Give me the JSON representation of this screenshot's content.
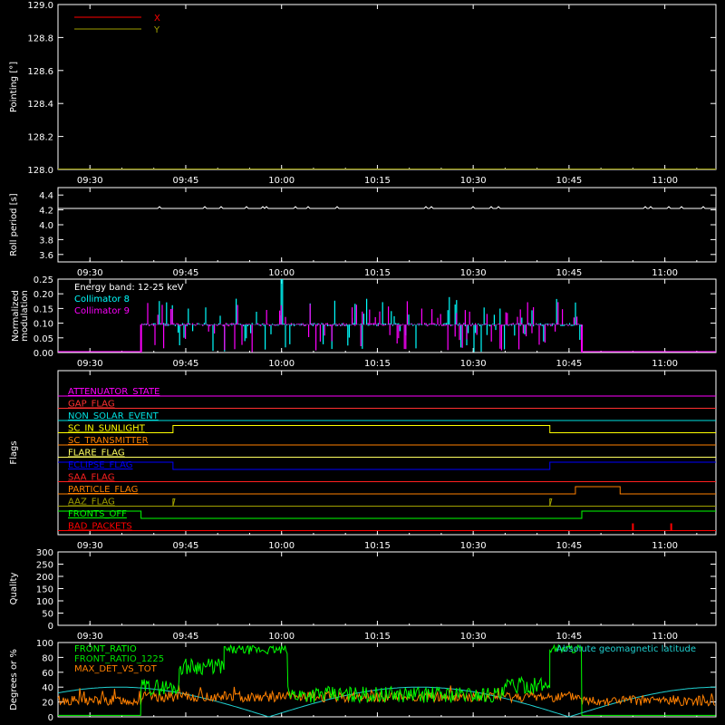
{
  "time_ticks": [
    "09:30",
    "09:45",
    "10:00",
    "10:15",
    "10:30",
    "10:45",
    "11:00"
  ],
  "chart_data": [
    {
      "type": "line",
      "name": "pointing",
      "ylabel": "Pointing [°]",
      "ylim": [
        128.0,
        129.0
      ],
      "yticks": [
        "128.0",
        "128.2",
        "128.4",
        "128.6",
        "128.8",
        "129.0"
      ],
      "legend_position": "top-left",
      "series": [
        {
          "name": "X",
          "color": "#ff0000",
          "x": [
            "09:25",
            "11:08"
          ],
          "values": [
            128.0,
            128.0
          ]
        },
        {
          "name": "Y",
          "color": "#a0a000",
          "x": [
            "09:25",
            "11:08"
          ],
          "values": [
            128.0,
            128.0
          ]
        }
      ]
    },
    {
      "type": "line",
      "name": "roll-period",
      "ylabel": "Roll period [s]",
      "ylim": [
        3.5,
        4.5
      ],
      "yticks": [
        "3.6",
        "3.8",
        "4.0",
        "4.2",
        "4.4"
      ],
      "series": [
        {
          "name": "",
          "color": "#ffffff",
          "x": [
            "09:25",
            "11:08"
          ],
          "values": [
            4.22,
            4.22
          ]
        }
      ]
    },
    {
      "type": "bar",
      "name": "modulation",
      "ylabel": "Normalized modulation",
      "ylim": [
        0,
        0.25
      ],
      "yticks": [
        "0.00",
        "0.05",
        "0.10",
        "0.15",
        "0.20",
        "0.25"
      ],
      "annotation": "Energy band: 12-25 keV",
      "data_range": [
        "09:38",
        "10:47"
      ],
      "baseline": 0.095,
      "series": [
        {
          "name": "Collimator 8",
          "color": "#00ffff"
        },
        {
          "name": "Collimator 9",
          "color": "#ff00ff"
        }
      ]
    },
    {
      "type": "line",
      "name": "flags",
      "ylabel": "Flags",
      "flags": [
        {
          "label": "ATTENUATOR_STATE",
          "color": "#ff00ff",
          "segments": [
            [
              "09:25",
              "11:08",
              0
            ]
          ]
        },
        {
          "label": "GAP_FLAG",
          "color": "#ff3030",
          "segments": [
            [
              "09:25",
              "11:08",
              0
            ]
          ]
        },
        {
          "label": "NON_SOLAR_EVENT",
          "color": "#00e0e0",
          "segments": [
            [
              "09:25",
              "11:08",
              0
            ]
          ]
        },
        {
          "label": "SC_IN_SUNLIGHT",
          "color": "#ffff00",
          "segments": [
            [
              "09:25",
              "09:43",
              0
            ],
            [
              "09:43",
              "10:42",
              1
            ],
            [
              "10:42",
              "11:08",
              0
            ]
          ]
        },
        {
          "label": "SC_TRANSMITTER",
          "color": "#ff8000",
          "segments": [
            [
              "09:25",
              "11:08",
              0
            ]
          ]
        },
        {
          "label": "FLARE_FLAG",
          "color": "#ffff60",
          "segments": [
            [
              "09:25",
              "11:08",
              0
            ]
          ]
        },
        {
          "label": "ECLIPSE_FLAG",
          "color": "#0000ff",
          "segments": [
            [
              "09:25",
              "09:43",
              1
            ],
            [
              "09:43",
              "10:42",
              0
            ],
            [
              "10:42",
              "11:08",
              1
            ]
          ]
        },
        {
          "label": "SAA_FLAG",
          "color": "#ff2020",
          "segments": [
            [
              "09:25",
              "11:08",
              0
            ]
          ]
        },
        {
          "label": "PARTICLE_FLAG",
          "color": "#ff8000",
          "segments": [
            [
              "09:25",
              "10:46",
              0
            ],
            [
              "10:46",
              "10:53",
              1
            ],
            [
              "10:53",
              "11:08",
              0
            ]
          ]
        },
        {
          "label": "AAZ_FLAG",
          "color": "#a0a000",
          "segments": [
            [
              "09:25",
              "09:43",
              0
            ],
            [
              "09:43",
              "09:43",
              1
            ],
            [
              "09:43",
              "10:42",
              0
            ],
            [
              "10:42",
              "10:42",
              1
            ],
            [
              "10:42",
              "11:08",
              0
            ]
          ]
        },
        {
          "label": "FRONTS_OFF",
          "color": "#00ff00",
          "segments": [
            [
              "09:25",
              "09:38",
              1
            ],
            [
              "09:38",
              "10:47",
              0
            ],
            [
              "10:47",
              "11:08",
              1
            ]
          ]
        },
        {
          "label": "BAD_PACKETS",
          "color": "#ff0000",
          "segments": [
            [
              "09:25",
              "11:08",
              0
            ]
          ],
          "spikes": [
            "10:55",
            "11:01"
          ]
        }
      ]
    },
    {
      "type": "line",
      "name": "quality",
      "ylabel": "Quality",
      "ylim": [
        0,
        300
      ],
      "yticks": [
        "0",
        "50",
        "100",
        "150",
        "200",
        "250",
        "300"
      ],
      "series": []
    },
    {
      "type": "line",
      "name": "ratios",
      "ylabel": "Degrees or %",
      "ylim": [
        0,
        100
      ],
      "yticks": [
        "0",
        "20",
        "40",
        "60",
        "80",
        "100"
      ],
      "series": [
        {
          "name": "FRONT_RATIO",
          "color": "#00ff00"
        },
        {
          "name": "FRONT_RATIO_1225",
          "color": "#00e000"
        },
        {
          "name": "MAX_DET_VS_TOT",
          "color": "#ff8000"
        },
        {
          "name": "Absolute geomagnetic latitude",
          "color": "#20d0d0"
        }
      ]
    }
  ]
}
